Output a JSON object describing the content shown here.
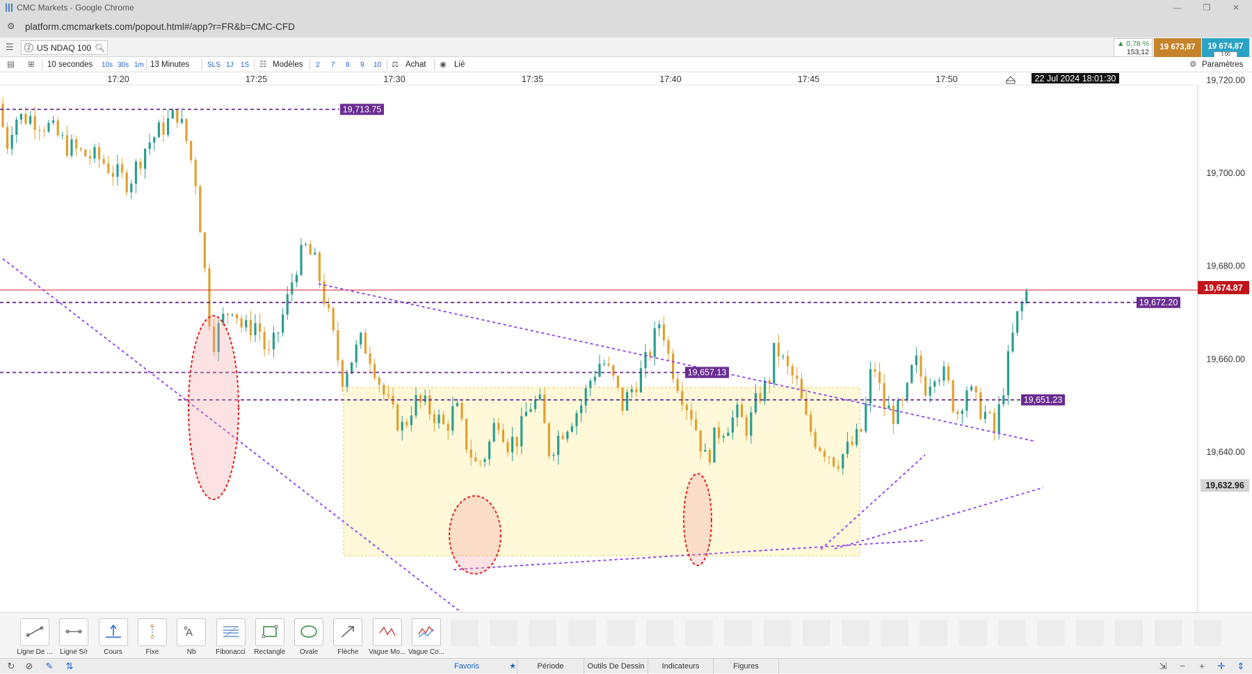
{
  "window": {
    "title": "CMC Markets - Google Chrome",
    "url": "platform.cmcmarkets.com/popout.html#/app?r=FR&b=CMC-CFD"
  },
  "instrument": {
    "badge": "2",
    "name": "US NDAQ 100"
  },
  "quote": {
    "change_pct": "▲ 0,78 %",
    "change_abs": "153,12",
    "sell": "19 673,87",
    "buy": "19 674,87",
    "size": "1.00"
  },
  "toolbar": {
    "interval": "10 secondes",
    "quick_intervals": [
      "10s",
      "30s",
      "1m"
    ],
    "duration": "13 Minutes",
    "quick_durations": [
      "SLS",
      "1J",
      "1S"
    ],
    "templates": "Modèles",
    "layouts": [
      "2",
      "7",
      "8",
      "9",
      "10"
    ],
    "buy_mode": "Achat",
    "linked": "Lié",
    "settings": "Paramètres"
  },
  "chart_data": {
    "type": "candlestick",
    "x_ticks": [
      "17:20",
      "17:25",
      "17:30",
      "17:35",
      "17:40",
      "17:45",
      "17:50"
    ],
    "y_ticks": [
      "19,720.00",
      "19,700.00",
      "19,680.00",
      "19,660.00",
      "19,640.00"
    ],
    "ylim": [
      19625,
      19735
    ],
    "crosshair_time": "22 Jul 2024 18:01:30",
    "current_price": "19,674.87",
    "low_marker": "19,632.96",
    "level_labels": [
      "19,713.75",
      "19,672.20",
      "19,657.13",
      "19,651.23"
    ],
    "levels": [
      19713.75,
      19672.2,
      19657.13,
      19651.23
    ],
    "colors": {
      "up": "#2a9d8f",
      "down": "#e0a030",
      "current": "#d32020",
      "level": "#6a2c91",
      "ellipse": "#e02020",
      "box": "#fff6cc"
    }
  },
  "draw_tools": [
    {
      "label": "Ligne De ...",
      "icon": "trend-line-icon"
    },
    {
      "label": "Ligne S/r",
      "icon": "sr-line-icon"
    },
    {
      "label": "Cours",
      "icon": "price-icon"
    },
    {
      "label": "Fixe",
      "icon": "fixed-icon"
    },
    {
      "label": "Nb",
      "icon": "text-icon"
    },
    {
      "label": "Fibonacci",
      "icon": "fibonacci-icon"
    },
    {
      "label": "Rectangle",
      "icon": "rectangle-icon"
    },
    {
      "label": "Ovale",
      "icon": "oval-icon"
    },
    {
      "label": "Flèche",
      "icon": "arrow-icon"
    },
    {
      "label": "Vague Mo...",
      "icon": "wave-icon"
    },
    {
      "label": "Vague Co...",
      "icon": "wave-correction-icon"
    }
  ],
  "bottom_tabs": [
    "Favoris",
    "Période",
    "Outils De Dessin",
    "Indicateurs",
    "Figures"
  ]
}
